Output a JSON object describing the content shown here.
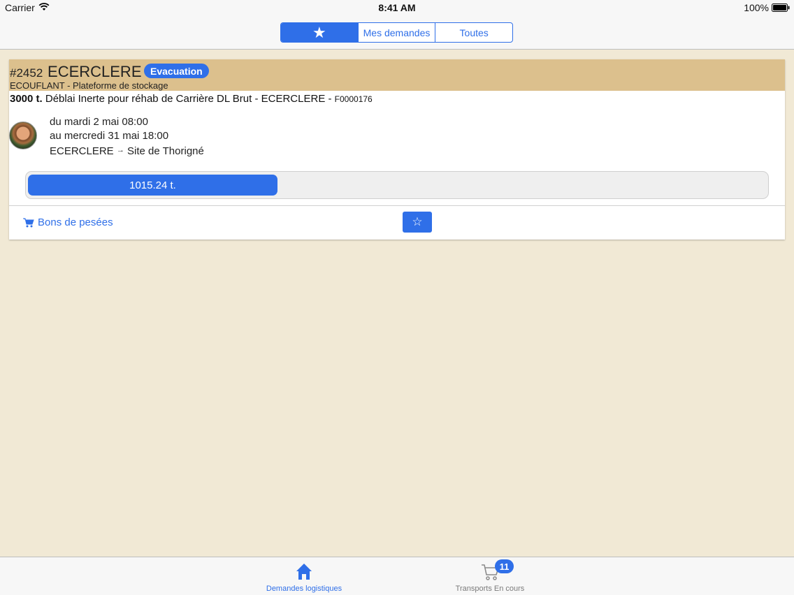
{
  "status_bar": {
    "carrier": "Carrier",
    "time": "8:41 AM",
    "battery": "100%"
  },
  "segments": [
    {
      "label": "★",
      "icon": "star-icon",
      "active": true
    },
    {
      "label": "Mes demandes",
      "active": false
    },
    {
      "label": "Toutes",
      "active": false
    }
  ],
  "request": {
    "number": "#2452",
    "name": "ECERCLERE",
    "badge": "Evacuation",
    "site": "ECOUFLANT - Plateforme de stockage",
    "quantity": "3000 t.",
    "description": "Déblai Inerte pour réhab de Carrière DL Brut - ECERCLERE -",
    "code": "F0000176",
    "date_from": "du mardi 2 mai 08:00",
    "date_to": "au mercredi 31 mai 18:00",
    "origin": "ECERCLERE",
    "destination": "Site de Thorigné",
    "progress_label": "1015.24 t.",
    "progress_fraction": 0.338,
    "bons_label": "Bons de pesées",
    "favorite_label": "☆"
  },
  "tabs": [
    {
      "label": "Demandes logistiques",
      "icon": "home-icon",
      "active": true
    },
    {
      "label": "Transports En cours",
      "icon": "cart-icon",
      "active": false,
      "badge": "11"
    }
  ],
  "colors": {
    "accent": "#2f6fe8",
    "header": "#dcc08d",
    "background": "#f1e9d5"
  }
}
